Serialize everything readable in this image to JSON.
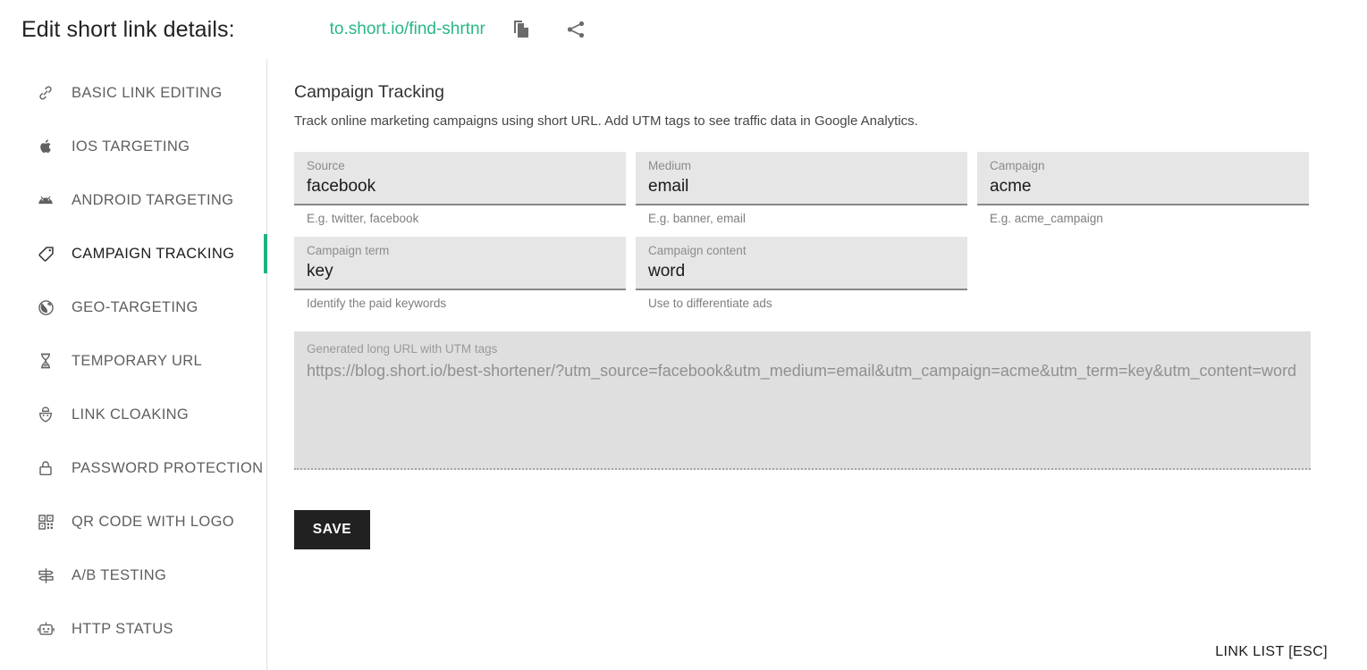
{
  "header": {
    "title": "Edit short link details:",
    "short_link": "to.short.io/find-shrtnr",
    "copy_icon": "copy-icon",
    "share_icon": "share-icon"
  },
  "sidebar": {
    "items": [
      {
        "label": "BASIC LINK EDITING",
        "icon": "link-icon",
        "active": false
      },
      {
        "label": "IOS TARGETING",
        "icon": "apple-icon",
        "active": false
      },
      {
        "label": "ANDROID TARGETING",
        "icon": "android-icon",
        "active": false
      },
      {
        "label": "CAMPAIGN TRACKING",
        "icon": "tag-icon",
        "active": true
      },
      {
        "label": "GEO-TARGETING",
        "icon": "globe-icon",
        "active": false
      },
      {
        "label": "TEMPORARY URL",
        "icon": "hourglass-icon",
        "active": false
      },
      {
        "label": "LINK CLOAKING",
        "icon": "mask-icon",
        "active": false
      },
      {
        "label": "PASSWORD PROTECTION",
        "icon": "lock-icon",
        "active": false
      },
      {
        "label": "QR CODE WITH LOGO",
        "icon": "qr-code-icon",
        "active": false
      },
      {
        "label": "A/B TESTING",
        "icon": "signpost-icon",
        "active": false
      },
      {
        "label": "HTTP STATUS",
        "icon": "robot-icon",
        "active": false
      }
    ]
  },
  "main": {
    "section_title": "Campaign Tracking",
    "section_description": "Track online marketing campaigns using short URL. Add UTM tags to see traffic data in Google Analytics.",
    "fields": [
      {
        "label": "Source",
        "value": "facebook",
        "hint": "E.g. twitter, facebook"
      },
      {
        "label": "Medium",
        "value": "email",
        "hint": "E.g. banner, email"
      },
      {
        "label": "Campaign",
        "value": "acme",
        "hint": "E.g. acme_campaign"
      },
      {
        "label": "Campaign term",
        "value": "key",
        "hint": "Identify the paid keywords"
      },
      {
        "label": "Campaign content",
        "value": "word",
        "hint": "Use to differentiate ads"
      }
    ],
    "generated": {
      "label": "Generated long URL with UTM tags",
      "value": "https://blog.short.io/best-shortener/?utm_source=facebook&utm_medium=email&utm_campaign=acme&utm_term=key&utm_content=word"
    },
    "save_label": "SAVE",
    "link_list_label": "LINK LIST [ESC]"
  },
  "colors": {
    "accent_green": "#2ab784",
    "active_indicator": "#1fb181",
    "field_bg": "#e6e6e6",
    "generated_bg": "#dfdfdf",
    "save_bg": "#212121"
  }
}
